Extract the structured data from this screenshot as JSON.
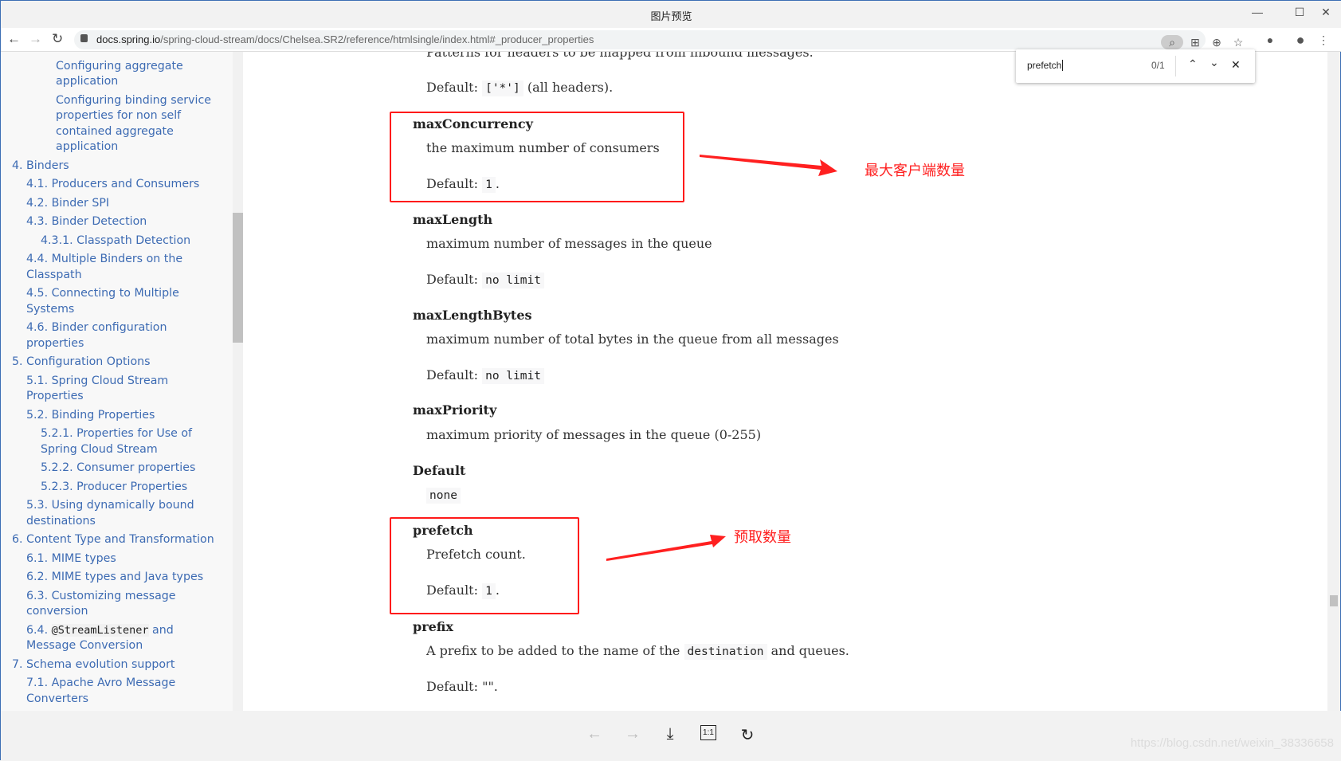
{
  "window": {
    "title": "图片预览"
  },
  "browser": {
    "url_host": "docs.spring.io",
    "url_path": "/spring-cloud-stream/docs/Chelsea.SR2/reference/htmlsingle/index.html#_producer_properties"
  },
  "find": {
    "query": "prefetch",
    "count": "0/1"
  },
  "toc": [
    {
      "level": 4,
      "label": "Configuring aggregate application"
    },
    {
      "level": 4,
      "label": "Configuring binding service properties for non self contained aggregate application"
    },
    {
      "level": 1,
      "label": "4. Binders"
    },
    {
      "level": 2,
      "label": "4.1. Producers and Consumers"
    },
    {
      "level": 2,
      "label": "4.2. Binder SPI"
    },
    {
      "level": 2,
      "label": "4.3. Binder Detection"
    },
    {
      "level": 3,
      "label": "4.3.1. Classpath Detection"
    },
    {
      "level": 2,
      "label": "4.4. Multiple Binders on the Classpath"
    },
    {
      "level": 2,
      "label": "4.5. Connecting to Multiple Systems"
    },
    {
      "level": 2,
      "label": "4.6. Binder configuration properties"
    },
    {
      "level": 1,
      "label": "5. Configuration Options"
    },
    {
      "level": 2,
      "label": "5.1. Spring Cloud Stream Properties"
    },
    {
      "level": 2,
      "label": "5.2. Binding Properties"
    },
    {
      "level": 3,
      "label": "5.2.1. Properties for Use of Spring Cloud Stream"
    },
    {
      "level": 3,
      "label": "5.2.2. Consumer properties"
    },
    {
      "level": 3,
      "label": "5.2.3. Producer Properties"
    },
    {
      "level": 2,
      "label": "5.3. Using dynamically bound destinations"
    },
    {
      "level": 1,
      "label": "6. Content Type and Transformation"
    },
    {
      "level": 2,
      "label": "6.1. MIME types"
    },
    {
      "level": 2,
      "label": "6.2. MIME types and Java types"
    },
    {
      "level": 2,
      "label": "6.3. Customizing message conversion"
    },
    {
      "level": 2,
      "label": "6.4. ",
      "code": "@StreamListener",
      "after": " and Message Conversion"
    },
    {
      "level": 1,
      "label": "7. Schema evolution support"
    },
    {
      "level": 2,
      "label": "7.1. Apache Avro Message Converters"
    }
  ],
  "content": {
    "top_desc": "Patterns for headers to be mapped from inbound messages.",
    "top_default_label": "Default:",
    "top_default_code": "['*']",
    "top_default_after": "(all headers).",
    "props": [
      {
        "name": "maxConcurrency",
        "desc": "the maximum number of consumers",
        "default_label": "Default:",
        "default": "1",
        "after": "."
      },
      {
        "name": "maxLength",
        "desc": "maximum number of messages in the queue",
        "default_label": "Default:",
        "default": "no limit",
        "after": ""
      },
      {
        "name": "maxLengthBytes",
        "desc": "maximum number of total bytes in the queue from all messages",
        "default_label": "Default:",
        "default": "no limit",
        "after": ""
      },
      {
        "name": "maxPriority",
        "desc": "maximum priority of messages in the queue (0-255)"
      },
      {
        "name": "Default",
        "code": "none"
      },
      {
        "name": "prefetch",
        "desc": "Prefetch count.",
        "default_label": "Default:",
        "default": "1",
        "after": "."
      },
      {
        "name": "prefix",
        "desc_before": "A prefix to be added to the name of the",
        "desc_code": "destination",
        "desc_after": "and queues.",
        "default_text": "Default: \"\"."
      }
    ]
  },
  "annotations": {
    "max_concurrency": "最大客户端数量",
    "prefetch": "预取数量",
    "color": "#ff2020"
  },
  "watermark": "https://blog.csdn.net/weixin_38336658"
}
